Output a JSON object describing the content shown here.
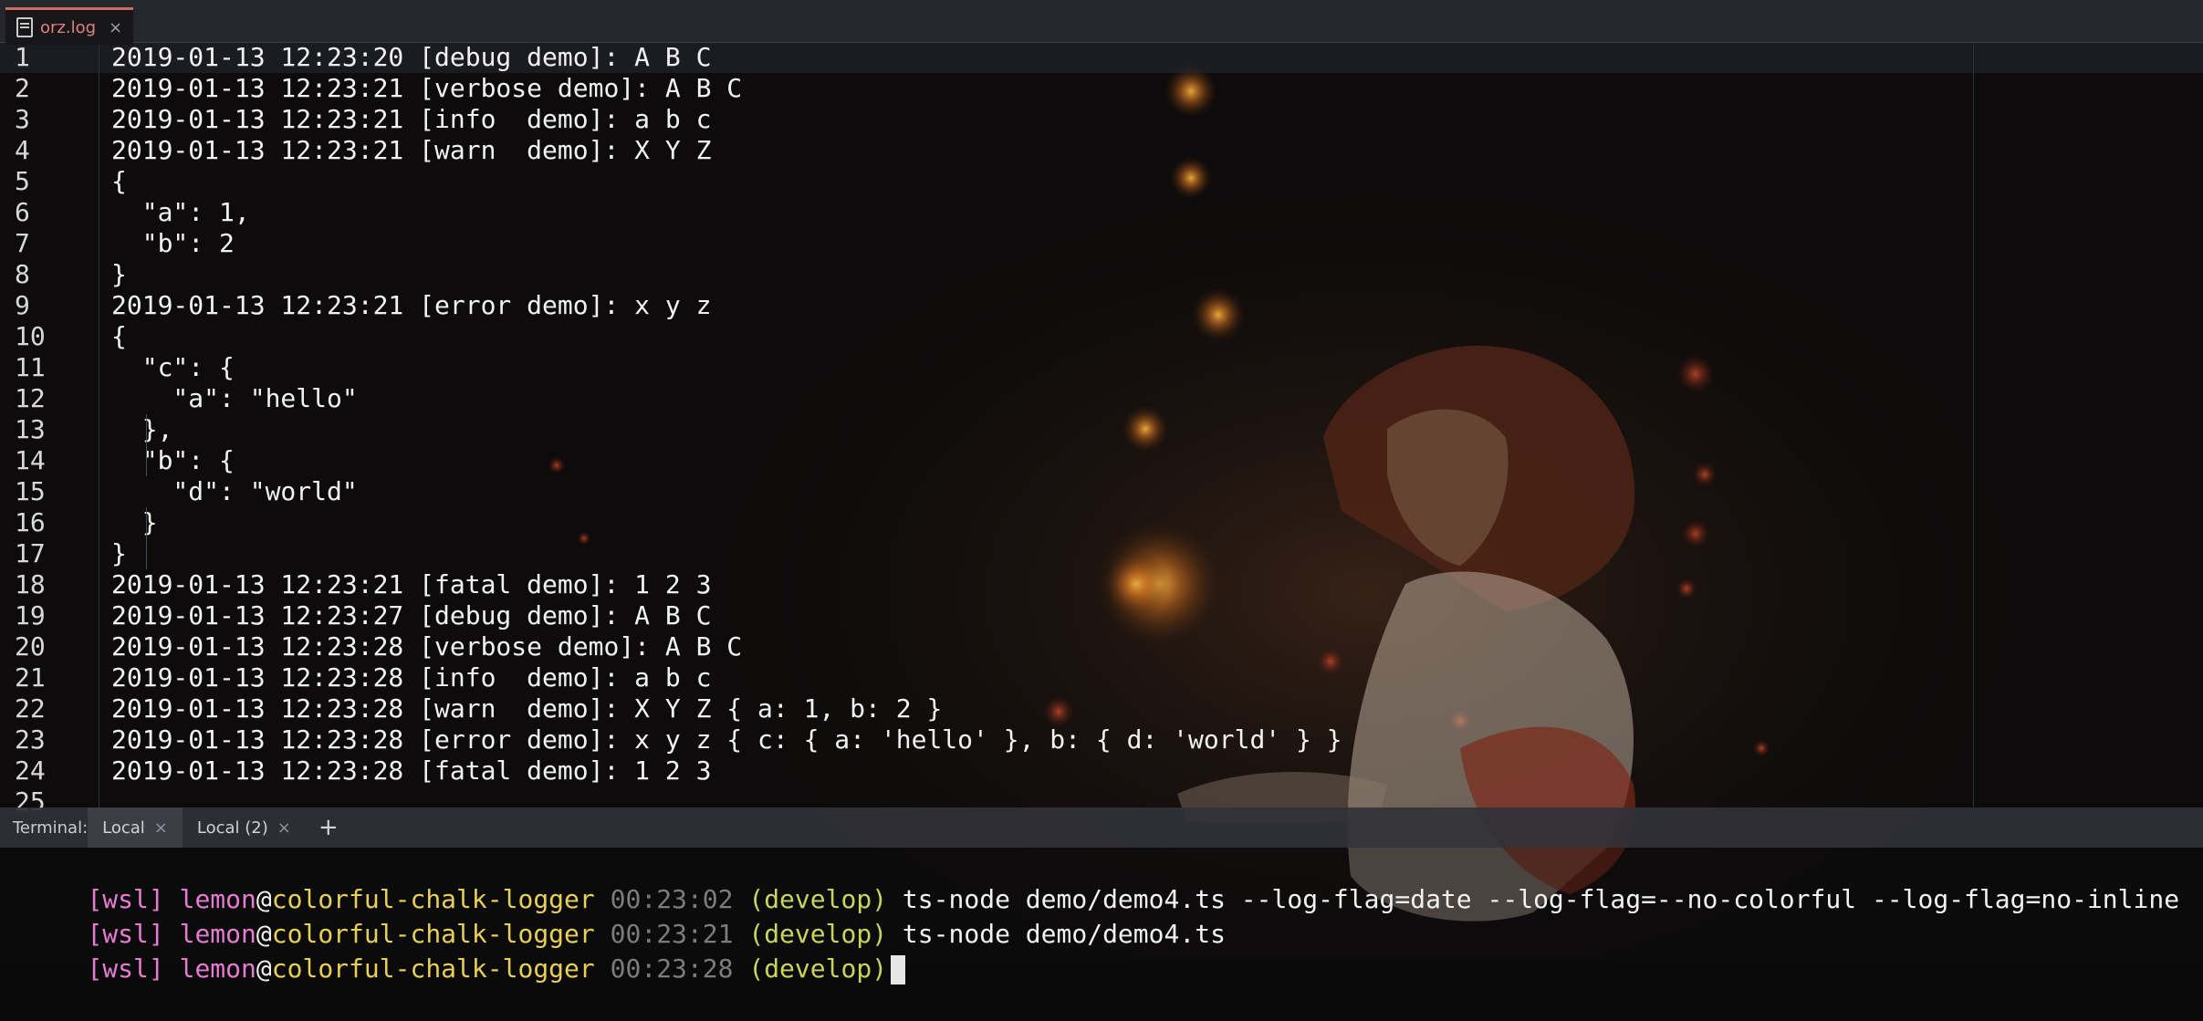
{
  "tab": {
    "filename": "orz.log",
    "icon": "document-icon",
    "accent": "#d06a6a"
  },
  "editor": {
    "lines": [
      {
        "n": "1",
        "text": "2019-01-13 12:23:20 [debug demo]: A B C"
      },
      {
        "n": "2",
        "text": "2019-01-13 12:23:21 [verbose demo]: A B C"
      },
      {
        "n": "3",
        "text": "2019-01-13 12:23:21 [info  demo]: a b c"
      },
      {
        "n": "4",
        "text": "2019-01-13 12:23:21 [warn  demo]: X Y Z"
      },
      {
        "n": "5",
        "text": "{"
      },
      {
        "n": "6",
        "text": "  \"a\": 1,"
      },
      {
        "n": "7",
        "text": "  \"b\": 2"
      },
      {
        "n": "8",
        "text": "}"
      },
      {
        "n": "9",
        "text": "2019-01-13 12:23:21 [error demo]: x y z"
      },
      {
        "n": "10",
        "text": "{"
      },
      {
        "n": "11",
        "text": "  \"c\": {"
      },
      {
        "n": "12",
        "text": "    \"a\": \"hello\""
      },
      {
        "n": "13",
        "text": "  },"
      },
      {
        "n": "14",
        "text": "  \"b\": {"
      },
      {
        "n": "15",
        "text": "    \"d\": \"world\""
      },
      {
        "n": "16",
        "text": "  }"
      },
      {
        "n": "17",
        "text": "}"
      },
      {
        "n": "18",
        "text": "2019-01-13 12:23:21 [fatal demo]: 1 2 3"
      },
      {
        "n": "19",
        "text": "2019-01-13 12:23:27 [debug demo]: A B C"
      },
      {
        "n": "20",
        "text": "2019-01-13 12:23:28 [verbose demo]: A B C"
      },
      {
        "n": "21",
        "text": "2019-01-13 12:23:28 [info  demo]: a b c"
      },
      {
        "n": "22",
        "text": "2019-01-13 12:23:28 [warn  demo]: X Y Z { a: 1, b: 2 }"
      },
      {
        "n": "23",
        "text": "2019-01-13 12:23:28 [error demo]: x y z { c: { a: 'hello' }, b: { d: 'world' } }"
      },
      {
        "n": "24",
        "text": "2019-01-13 12:23:28 [fatal demo]: 1 2 3"
      },
      {
        "n": "25",
        "text": ""
      }
    ]
  },
  "terminal": {
    "label": "Terminal:",
    "tabs": [
      {
        "label": "Local",
        "close": "×"
      },
      {
        "label": "Local (2)",
        "close": "×"
      }
    ],
    "add_label": "+",
    "prompts": [
      {
        "env": "[wsl]",
        "user": "lemon",
        "at": "@",
        "host": "colorful-chalk-logger",
        "time": "00:23:02",
        "branch": "(develop)",
        "cmd": "ts-node demo/demo4.ts --log-flag=date --log-flag=--no-colorful --log-flag=no-inline"
      },
      {
        "env": "[wsl]",
        "user": "lemon",
        "at": "@",
        "host": "colorful-chalk-logger",
        "time": "00:23:21",
        "branch": "(develop)",
        "cmd": "ts-node demo/demo4.ts"
      },
      {
        "env": "[wsl]",
        "user": "lemon",
        "at": "@",
        "host": "colorful-chalk-logger",
        "time": "00:23:28",
        "branch": "(develop)",
        "cmd": ""
      }
    ]
  },
  "colors": {
    "prompt_env": "#e67bd2",
    "prompt_host": "#e8cf55",
    "prompt_time": "#7c7c7c",
    "prompt_branch": "#c9d55a"
  }
}
